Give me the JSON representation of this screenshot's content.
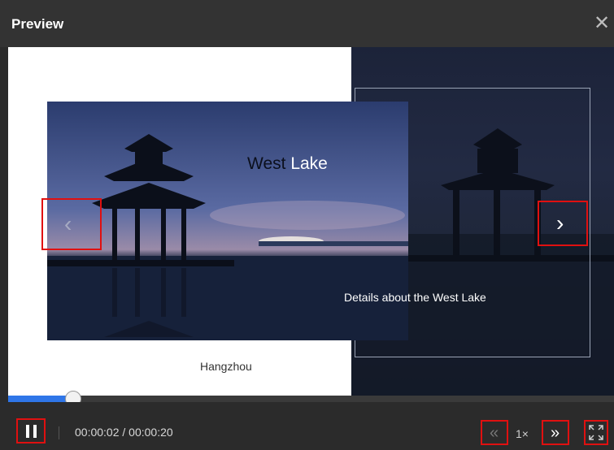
{
  "dialog": {
    "title": "Preview",
    "close_icon": "close-icon"
  },
  "slide": {
    "title_part1": "West",
    "title_part2": "Lake",
    "details": "Details about the West Lake",
    "caption": "Hangzhou",
    "image": "west-lake-pavilion-photo"
  },
  "navigation": {
    "prev_icon": "chevron-left-icon",
    "next_icon": "chevron-right-icon"
  },
  "player": {
    "progress": 0.1,
    "time": "00:00:02 / 00:00:20",
    "speed": "1×",
    "pause_icon": "pause-icon",
    "rewind_icon": "rewind-icon",
    "forward_icon": "fast-forward-icon",
    "fullscreen_icon": "fullscreen-icon",
    "accent_color": "#2f76e8",
    "highlight_color": "#e01010"
  }
}
